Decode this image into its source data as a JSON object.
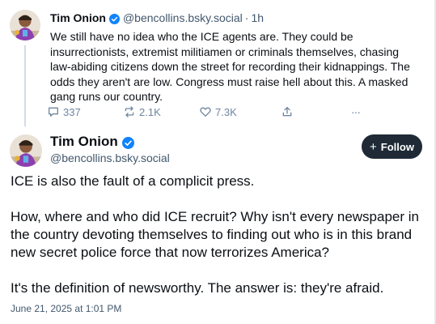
{
  "parent_post": {
    "author_name": "Tim Onion",
    "handle": "@bencollins.bsky.social",
    "separator": "·",
    "time": "1h",
    "text": "We still have no idea who the ICE agents are. They could be insurrectionists, extremist militiamen or criminals themselves, chasing law-abiding citizens down the street for recording their kidnappings. The odds they aren't are low. Congress must raise hell about this. A masked gang runs our country.",
    "actions": {
      "replies": "337",
      "reposts": "2.1K",
      "likes": "7.3K",
      "more": "···"
    }
  },
  "main_post": {
    "author_name": "Tim Onion",
    "handle": "@bencollins.bsky.social",
    "follow_plus": "+",
    "follow_label": "Follow",
    "paragraphs": [
      "ICE is also the fault of a complicit press.",
      "How, where and who did ICE recruit? Why isn't every newspaper in the country devoting themselves to finding out who is in this brand new secret police force that now terrorizes America?",
      "It's the definition of newsworthy. The answer is: they're afraid."
    ],
    "date": "June 21, 2025 at 1:01 PM"
  },
  "colors": {
    "verified": "#1083fe",
    "follow_button_bg": "#1f2a36",
    "muted_text": "#42576c",
    "action_icon": "#6f869f"
  }
}
